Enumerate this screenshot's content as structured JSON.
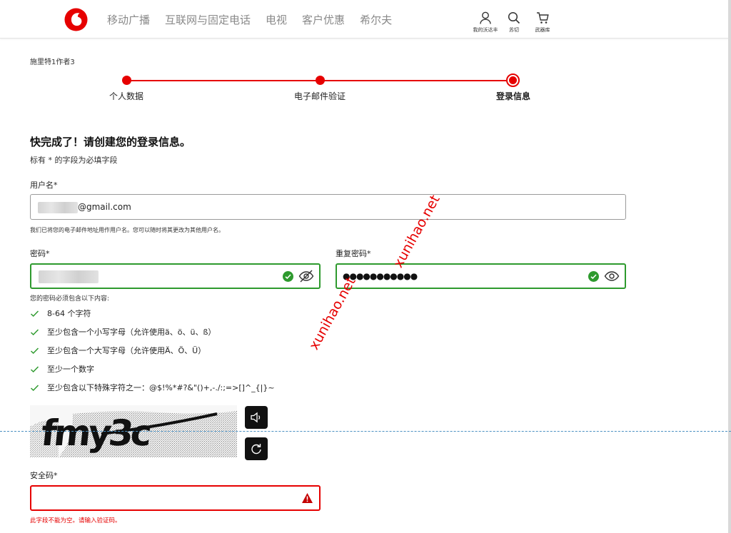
{
  "header": {
    "nav": [
      "移动广播",
      "互联网与固定电话",
      "电视",
      "客户优惠",
      "希尔夫"
    ],
    "icons": [
      {
        "icon": "person-icon",
        "label": "我的沃达丰"
      },
      {
        "icon": "search-icon",
        "label": "苏切"
      },
      {
        "icon": "cart-icon",
        "label": "武器库"
      }
    ],
    "brand_color": "#e60000"
  },
  "breadcrumb": "施里特1作者3",
  "stepper": {
    "steps": [
      "个人数据",
      "电子邮件验证",
      "登录信息"
    ],
    "current_step": 3
  },
  "form": {
    "title": "快完成了！请创建您的登录信息。",
    "required_note": "标有 * 的字段为必填字段",
    "username": {
      "label": "用户名*",
      "value_suffix": "@gmail.com",
      "help": "我们已将您的电子邮件地址用作用户名。您可以随时将其更改为其他用户名。"
    },
    "password": {
      "label": "密码*",
      "status": "valid"
    },
    "repeat_password": {
      "label": "重复密码*",
      "masked_value": "●●●●●●●●●●●",
      "status": "valid"
    },
    "requirements": {
      "heading": "您的密码必须包含以下内容:",
      "items": [
        "8-64 个字符",
        "至少包含一个小写字母（允许使用ä、ö、ü、ß）",
        "至少包含一个大写字母（允许使用Ä、Ö、Ü）",
        "至少一个数字",
        "至少包含以下特殊字符之一：@$!%*#?&\"()+,-./:;=>[]^_{|}~"
      ]
    },
    "captcha": {
      "text": "fmy3c",
      "audio_icon": "speaker-icon",
      "refresh_icon": "refresh-icon"
    },
    "security_code": {
      "label": "安全码*",
      "value": "",
      "error": "此字段不能为空。请输入验证码。"
    }
  },
  "watermark": "xunihao.net"
}
